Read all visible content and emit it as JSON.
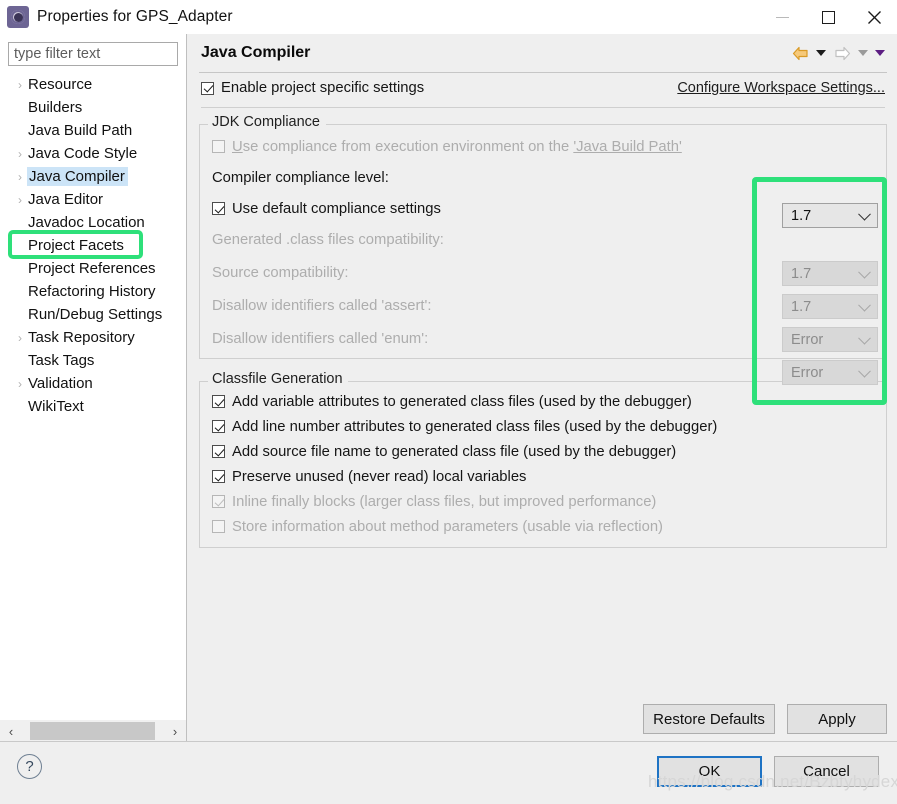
{
  "window": {
    "title": "Properties for GPS_Adapter",
    "icon": "settings-gear-icon",
    "minimize_label": "–",
    "maximize_label": "□",
    "close_label": "✕"
  },
  "sidebar": {
    "filter_placeholder": "type filter text",
    "filter_value": "",
    "scroll_left_label": "‹",
    "scroll_right_label": "›",
    "items": [
      {
        "label": "Resource",
        "expandable": true,
        "selected": false
      },
      {
        "label": "Builders",
        "expandable": false,
        "selected": false
      },
      {
        "label": "Java Build Path",
        "expandable": false,
        "selected": false
      },
      {
        "label": "Java Code Style",
        "expandable": true,
        "selected": false
      },
      {
        "label": "Java Compiler",
        "expandable": true,
        "selected": true
      },
      {
        "label": "Java Editor",
        "expandable": true,
        "selected": false
      },
      {
        "label": "Javadoc Location",
        "expandable": false,
        "selected": false
      },
      {
        "label": "Project Facets",
        "expandable": false,
        "selected": false
      },
      {
        "label": "Project References",
        "expandable": false,
        "selected": false
      },
      {
        "label": "Refactoring History",
        "expandable": false,
        "selected": false
      },
      {
        "label": "Run/Debug Settings",
        "expandable": false,
        "selected": false,
        "truncated": true
      },
      {
        "label": "Task Repository",
        "expandable": true,
        "selected": false
      },
      {
        "label": "Task Tags",
        "expandable": false,
        "selected": false
      },
      {
        "label": "Validation",
        "expandable": true,
        "selected": false
      },
      {
        "label": "WikiText",
        "expandable": false,
        "selected": false
      }
    ]
  },
  "page": {
    "title": "Java Compiler",
    "nav": {
      "back_icon": "back-arrow-icon",
      "back_dropdown_icon": "chevron-down-icon",
      "forward_icon": "forward-arrow-icon",
      "forward_dropdown_icon": "chevron-down-icon",
      "menu_dropdown_icon": "chevron-down-icon"
    },
    "enable_project_specific": {
      "label": "Enable project specific settings",
      "checked": true
    },
    "configure_workspace_link": "Configure Workspace Settings...",
    "jdk_compliance": {
      "title": "JDK Compliance",
      "use_execution_env": {
        "label_prefix": "Use compliance from execution environment on the ",
        "label_link": "'Java Build Path'",
        "checked": false,
        "enabled": false
      },
      "compiler_compliance_level": {
        "label": "Compiler compliance level:",
        "value": "1.7",
        "enabled": true
      },
      "use_default_compliance": {
        "label": "Use default compliance settings",
        "checked": true,
        "enabled": true
      },
      "rows": [
        {
          "label": "Generated .class files compatibility:",
          "value": "1.7",
          "enabled": false
        },
        {
          "label": "Source compatibility:",
          "value": "1.7",
          "enabled": false
        },
        {
          "label": "Disallow identifiers called 'assert':",
          "value": "Error",
          "enabled": false
        },
        {
          "label": "Disallow identifiers called 'enum':",
          "value": "Error",
          "enabled": false
        }
      ]
    },
    "classfile_generation": {
      "title": "Classfile Generation",
      "options": [
        {
          "label": "Add variable attributes to generated class files (used by the debugger)",
          "checked": true,
          "enabled": true
        },
        {
          "label": "Add line number attributes to generated class files (used by the debugger)",
          "checked": true,
          "enabled": true
        },
        {
          "label": "Add source file name to generated class file (used by the debugger)",
          "checked": true,
          "enabled": true
        },
        {
          "label": "Preserve unused (never read) local variables",
          "checked": true,
          "enabled": true
        },
        {
          "label": "Inline finally blocks (larger class files, but improved performance)",
          "checked": true,
          "enabled": false
        },
        {
          "label": "Store information about method parameters (usable via reflection)",
          "checked": false,
          "enabled": false
        }
      ]
    },
    "buttons": {
      "restore_defaults": "Restore Defaults",
      "apply": "Apply"
    }
  },
  "footer": {
    "help_label": "?",
    "ok": "OK",
    "cancel": "Cancel"
  },
  "watermark": "https://blog.csdn.net/Bzbtyhydexy",
  "colors": {
    "highlight_green": "#2ee07a",
    "selection_blue": "#cce4f7",
    "ok_focus_blue": "#1e73c4",
    "panel_grey": "#efefef",
    "back_arrow_gold": "#e8a33d"
  }
}
